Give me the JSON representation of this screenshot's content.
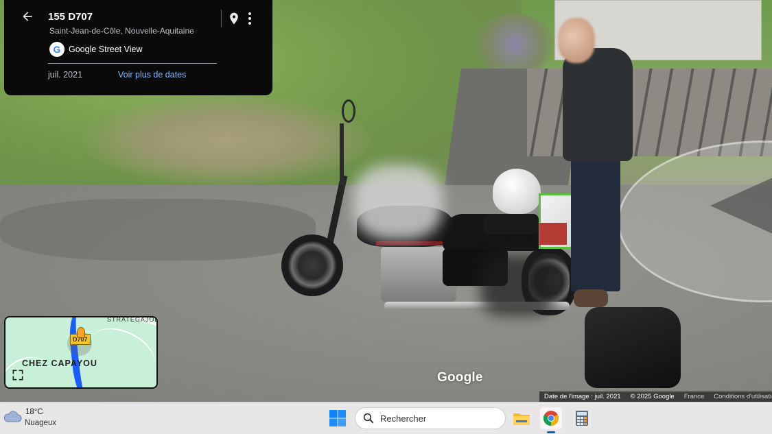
{
  "window": {
    "title": "155 D707"
  },
  "info_card": {
    "title": "155 D707",
    "subtitle": "Saint-Jean-de-Côle, Nouvelle-Aquitaine",
    "brand_label": "Google Street View",
    "brand_letter": "G",
    "capture_date": "juil. 2021",
    "more_dates_link": "Voir plus de dates",
    "icons": {
      "back": "arrow-left-icon",
      "location": "map-pin-icon",
      "menu": "more-vert-icon"
    }
  },
  "viewer": {
    "watermark": "Google"
  },
  "minimap": {
    "place_label": "CHEZ CAPAYOU",
    "road_badge": "D707",
    "top_label": "STRATEGAJOL",
    "icons": {
      "expand": "fullscreen-icon",
      "pegman": "pegman-icon"
    }
  },
  "attribution": {
    "image_date": "Date de l'image : juil. 2021",
    "copyright": "© 2025 Google",
    "region": "France",
    "terms": "Conditions d'utilisation"
  },
  "taskbar": {
    "weather": {
      "temperature": "18°C",
      "condition": "Nuageux",
      "icon": "cloud-icon"
    },
    "search_placeholder": "Rechercher",
    "apps": [
      "windows-start-icon",
      "file-explorer-icon",
      "chrome-icon",
      "calculator-icon"
    ]
  },
  "colors": {
    "card_bg": "#0a0a0a",
    "link": "#8ab4f8",
    "route_blue": "#1a5cff",
    "map_bg": "#c8f0d8",
    "taskbar_bg": "#e8e6e6",
    "accent": "#0067c0"
  }
}
